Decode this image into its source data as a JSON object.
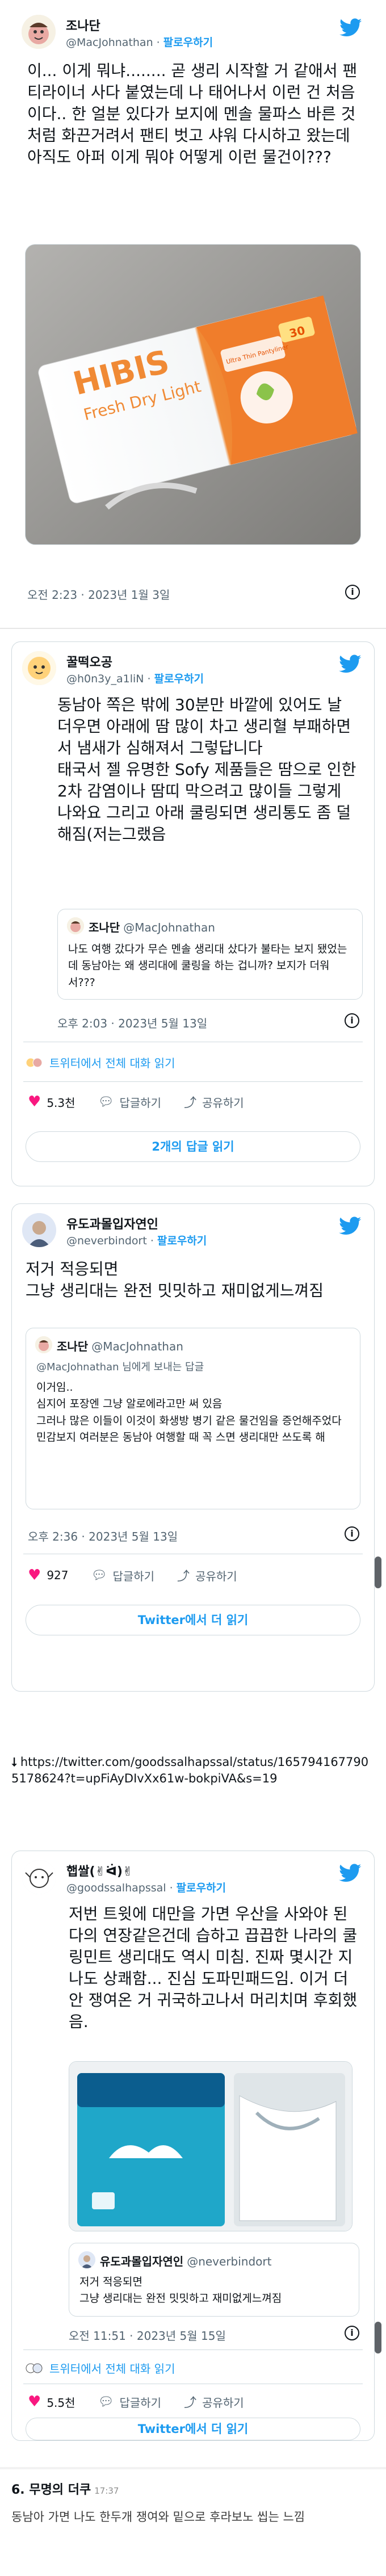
{
  "tweet1": {
    "name": "조나단",
    "handle": "@MacJohnathan",
    "follow": "팔로우하기",
    "text": "이... 이게 뭐냐........ 곧 생리 시작할 거 같애서 팬티라이너 사다 붙였는데 나 태어나서 이런 건 처음이다.. 한 얼분 있다가 보지에 멘솔 물파스 바른 것처럼 화끈거려서 팬티 벗고 샤워 다시하고 왔는데 아직도 아퍼 이게 뭐야 어떻게 이런 물건이???",
    "product": {
      "brand": "HIBIS",
      "line": "Fresh Dry Light",
      "count": "30",
      "tag": "Ultra Thin Pantyliner"
    },
    "time": "오전 2:23 · 2023년 1월 3일"
  },
  "tweet2": {
    "name": "꿀떡오공",
    "handle": "@h0n3y_a1liN",
    "follow": "팔로우하기",
    "text": "동남아 쪽은 밖에 30분만 바깥에 있어도 날 더우면 아래에 땀 많이 차고 생리혈 부패하면서 냄새가 심해져서 그렇답니다\n태국서 젤 유명한 Sofy 제품들은 땀으로 인한 2차 감염이나 땀띠 막으려고 많이들 그렇게 나와요 그리고 아래 쿨링되면 생리통도 좀 덜해짐(저는그랬음",
    "quote": {
      "name": "조나단",
      "handle": "@MacJohnathan",
      "text": "나도 여행 갔다가 무슨 멘솔 생리대 샀다가 불타는 보지 됐었는데 동남아는 왜 생리대에 쿨링을 하는 겁니까? 보지가 더워서???"
    },
    "time": "오후 2:03 · 2023년 5월 13일",
    "thread": "트위터에서 전체 대화 읽기",
    "likes": "5.3천",
    "reply": "답글하기",
    "share": "공유하기",
    "replies_button": "2개의 답글 읽기"
  },
  "tweet3": {
    "name": "유도과몰입자연인",
    "handle": "@neverbindort",
    "follow": "팔로우하기",
    "text": "저거 적응되면\n그냥 생리대는 완전 밋밋하고 재미없게느껴짐",
    "quote": {
      "name": "조나단",
      "handle": "@MacJohnathan",
      "reply_to": "@MacJohnathan 님에게 보내는 답글",
      "text": "이거임..\n심지어 포장엔 그냥 알로에라고만 써 있음\n그러나 많은 이들이 이것이 화생방 병기 같은 물건임을 증언해주었다\n민감보지 여러분은 동남아 여행할 때 꼭 스면 생리대만 쓰도록 해"
    },
    "time": "오후 2:36 · 2023년 5월 13일",
    "likes": "927",
    "reply": "답글하기",
    "share": "공유하기",
    "read_more": "Twitter에서 더 읽기"
  },
  "link": "https://twitter.com/goodssalhapssal/status/1657941677905178624?t=upFiAyDIvXx61w-bokpiVA&s=19",
  "tweet4": {
    "name": "햅쌀(✌ᐛ)✌",
    "handle": "@goodssalhapssal",
    "follow": "팔로우하기",
    "text": "저번 트윗에 대만을 가면 우산을 사와야 된다의 연장같은건데 습하고 끕끕한 나라의 쿨링민트 생리대도 역시 미침. 진짜 몇시간 지나도 상쾌함... 진심 도파민패드임. 이거 더 안 쟁여온 거 귀국하고나서 머리치며 후회했음.",
    "quote": {
      "name": "유도과몰입자연인",
      "handle": "@neverbindort",
      "text": "저거 적응되면\n그냥 생리대는 완전 밋밋하고 재미없게느껴짐"
    },
    "quote_time": "오전 11:51 · 2023년 5월 15일",
    "thread": "트위터에서 전체 대화 읽기",
    "likes": "5.5천",
    "reply": "답글하기",
    "share": "공유하기",
    "read_more": "Twitter에서 더 읽기"
  },
  "comment": {
    "title": "6. 무명의 더쿠",
    "time": "17:37",
    "text": "동남아 가면 나도 한두개 쟁여와 밑으로 후라보노 씹는 느낌"
  },
  "colors": {
    "accent": "#1d9bf0",
    "like": "#f91880",
    "border": "#cfd9de"
  }
}
